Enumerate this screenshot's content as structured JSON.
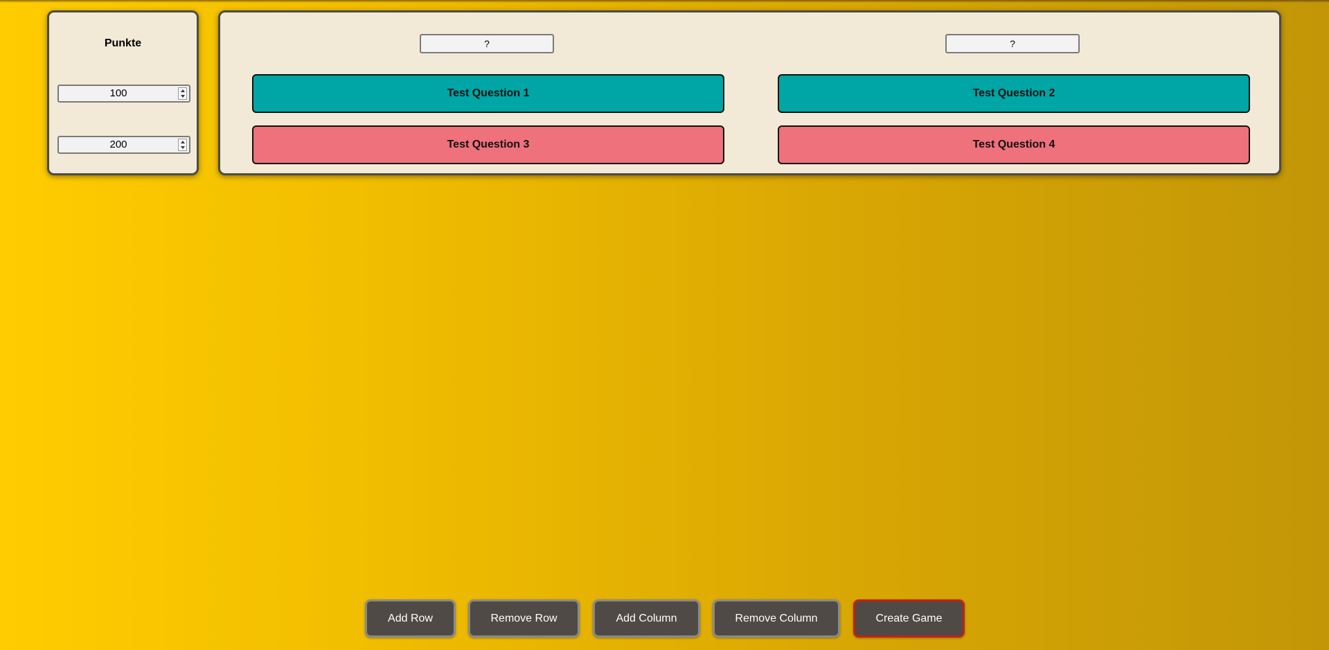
{
  "points": {
    "title": "Punkte",
    "values": [
      "100",
      "200"
    ]
  },
  "board": {
    "column_headers": [
      "?",
      "?"
    ],
    "questions": [
      {
        "label": "Test Question 1",
        "color": "#00a5a5"
      },
      {
        "label": "Test Question 2",
        "color": "#00a5a5"
      },
      {
        "label": "Test Question 3",
        "color": "#ee717b"
      },
      {
        "label": "Test Question 4",
        "color": "#ee717b"
      }
    ]
  },
  "toolbar": {
    "add_row": "Add Row",
    "remove_row": "Remove Row",
    "add_column": "Add Column",
    "remove_column": "Remove Column",
    "create_game": "Create Game"
  },
  "colors": {
    "background_start": "#ffcc00",
    "background_end": "#c29607",
    "panel": "#f2ead7",
    "button": "#4f4a45",
    "create_border": "#c0221c"
  }
}
